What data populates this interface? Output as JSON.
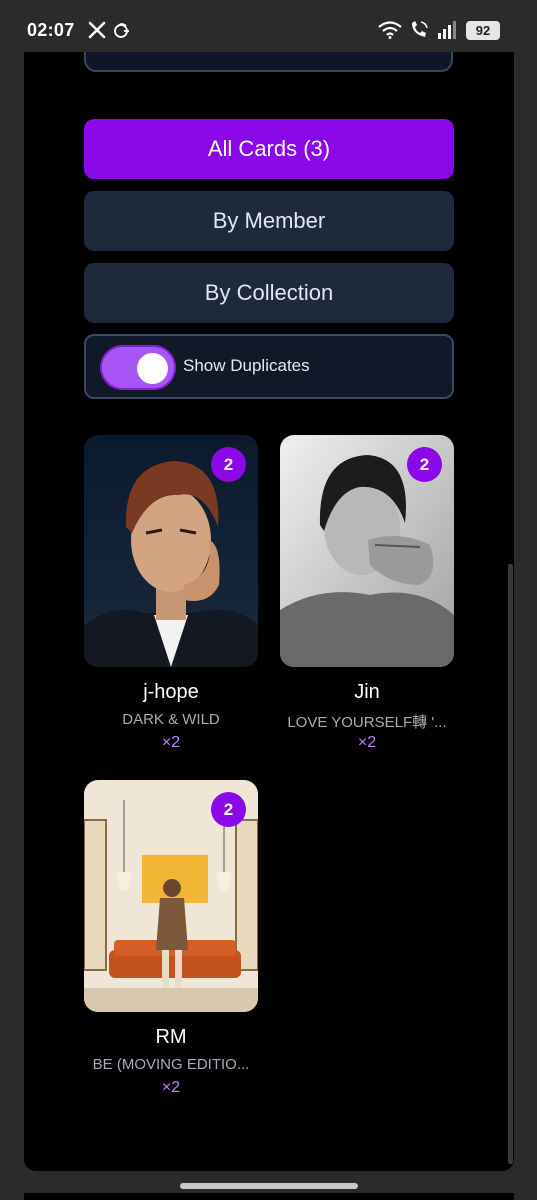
{
  "status_bar": {
    "time": "02:07",
    "battery": "92",
    "icons": [
      "x-logo-icon",
      "notification-icon",
      "wifi-icon",
      "wifi-call-icon",
      "signal-icon",
      "battery-icon"
    ]
  },
  "filters": {
    "all_label": "All Cards (3)",
    "member_label": "By Member",
    "collection_label": "By Collection",
    "active": "all"
  },
  "duplicates": {
    "label": "Show Duplicates",
    "enabled": true
  },
  "cards": [
    {
      "member": "j-hope",
      "collection": "DARK & WILD",
      "badge": "2",
      "quantity": "×2"
    },
    {
      "member": "Jin",
      "collection": "LOVE YOURSELF轉 '...",
      "badge": "2",
      "quantity": "×2"
    },
    {
      "member": "RM",
      "collection": "BE (MOVING EDITIO...",
      "badge": "2",
      "quantity": "×2"
    }
  ],
  "colors": {
    "accent": "#8b08e8",
    "toggle_on": "#a855f7",
    "button_bg": "#1e293b",
    "quantity_text": "#c084fc"
  }
}
